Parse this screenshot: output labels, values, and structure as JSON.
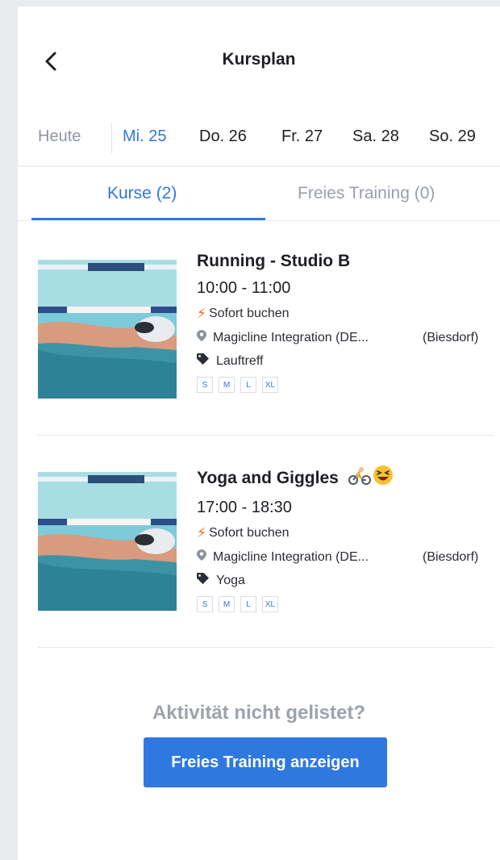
{
  "header": {
    "title": "Kursplan"
  },
  "dates": [
    {
      "label": "Heute",
      "state": "today"
    },
    {
      "label": "Mi. 25",
      "state": "active"
    },
    {
      "label": "Do. 26",
      "state": "normal"
    },
    {
      "label": "Fr. 27",
      "state": "normal"
    },
    {
      "label": "Sa. 28",
      "state": "normal"
    },
    {
      "label": "So. 29",
      "state": "normal"
    }
  ],
  "tabs": [
    {
      "label": "Kurse (2)",
      "active": true
    },
    {
      "label": "Freies Training (0)",
      "active": false
    }
  ],
  "classes": [
    {
      "name": "Running - Studio B",
      "time": "10:00 - 11:00",
      "booking": "Sofort buchen",
      "location": "Magicline Integration (DE...",
      "studio": "(Biesdorf)",
      "tag": "Lauftreff",
      "sizes": [
        "S",
        "M",
        "L",
        "XL"
      ],
      "emojis": []
    },
    {
      "name": "Yoga and Giggles",
      "time": "17:00 - 18:30",
      "booking": "Sofort buchen",
      "location": "Magicline Integration (DE...",
      "studio": "(Biesdorf)",
      "tag": "Yoga",
      "sizes": [
        "S",
        "M",
        "L",
        "XL"
      ],
      "emojis": [
        "cyclist-emoji",
        "laughing-face-emoji"
      ]
    }
  ],
  "footer": {
    "prompt": "Aktivität nicht gelistet?",
    "button_label": "Freies Training anzeigen"
  },
  "colors": {
    "accent": "#2f78e0",
    "bolt": "#f16a23",
    "muted": "#9a9fa8",
    "background": "#e9ebef"
  }
}
